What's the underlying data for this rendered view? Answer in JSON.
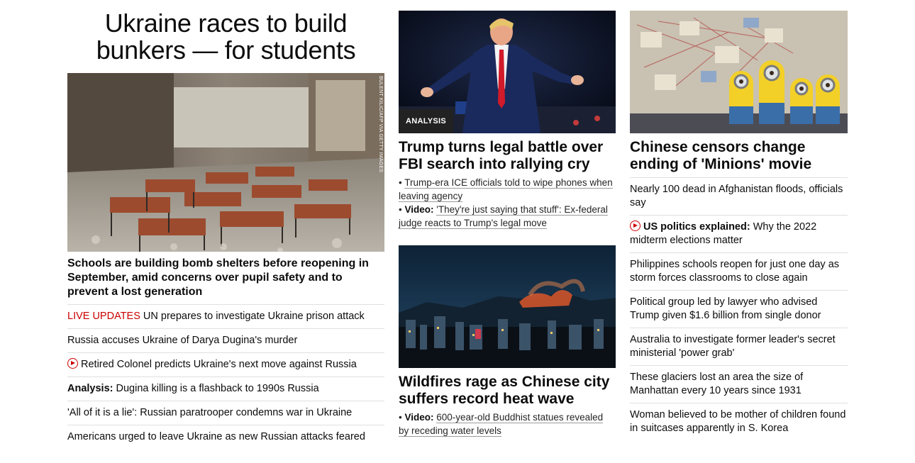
{
  "col1": {
    "hero_title_line1": "Ukraine races to build",
    "hero_title_line2": "bunkers — for students",
    "image_credit": "BULENT KILIC/AFP VIA GETTY IMAGES",
    "hero_sub": "Schools are building bomb shelters before reopening in September, amid concerns over pupil safety and to prevent a lost generation",
    "list": [
      {
        "prefix": "LIVE UPDATES",
        "text": " UN prepares to investigate Ukraine prison attack"
      },
      {
        "text": "Russia accuses Ukraine of Darya Dugina's murder"
      },
      {
        "icon": "play-icon",
        "text": "Retired Colonel predicts Ukraine's next move against Russia"
      },
      {
        "prefix": "Analysis:",
        "text": " Dugina killing is a flashback to 1990s Russia"
      },
      {
        "text": "'All of it is a lie': Russian paratrooper condemns war in Ukraine"
      },
      {
        "text": "Americans urged to leave Ukraine as new Russian attacks feared"
      }
    ]
  },
  "col2": {
    "story1": {
      "badge": "ANALYSIS",
      "headline": "Trump turns legal battle over FBI search into rallying cry",
      "bullet1": "Trump-era ICE officials told to wipe phones when leaving agency",
      "bullet2_prefix": "Video:",
      "bullet2": "'They're just saying that stuff': Ex-federal judge reacts to Trump's legal move"
    },
    "story2": {
      "headline": "Wildfires rage as Chinese city suffers record heat wave",
      "bullet1_prefix": "Video:",
      "bullet1": "600-year-old Buddhist statues revealed by receding water levels"
    }
  },
  "col3": {
    "headline": "Chinese censors change ending of 'Minions' movie",
    "list": [
      {
        "text": "Nearly 100 dead in Afghanistan floods, officials say"
      },
      {
        "icon": "play-icon",
        "prefix": "US politics explained:",
        "text": " Why the 2022 midterm elections matter"
      },
      {
        "text": "Philippines schools reopen for just one day as storm forces classrooms to close again"
      },
      {
        "text": "Political group led by lawyer who advised Trump given $1.6 billion from single donor"
      },
      {
        "text": "Australia to investigate former leader's secret ministerial 'power grab'"
      },
      {
        "text": "These glaciers lost an area the size of Manhattan every 10 years since 1931"
      },
      {
        "text": "Woman believed to be mother of children found in suitcases apparently in S. Korea"
      }
    ]
  },
  "colors": {
    "accent_red": "#cc0000",
    "text": "#0c0c0c",
    "divider": "#e0e0e0"
  }
}
